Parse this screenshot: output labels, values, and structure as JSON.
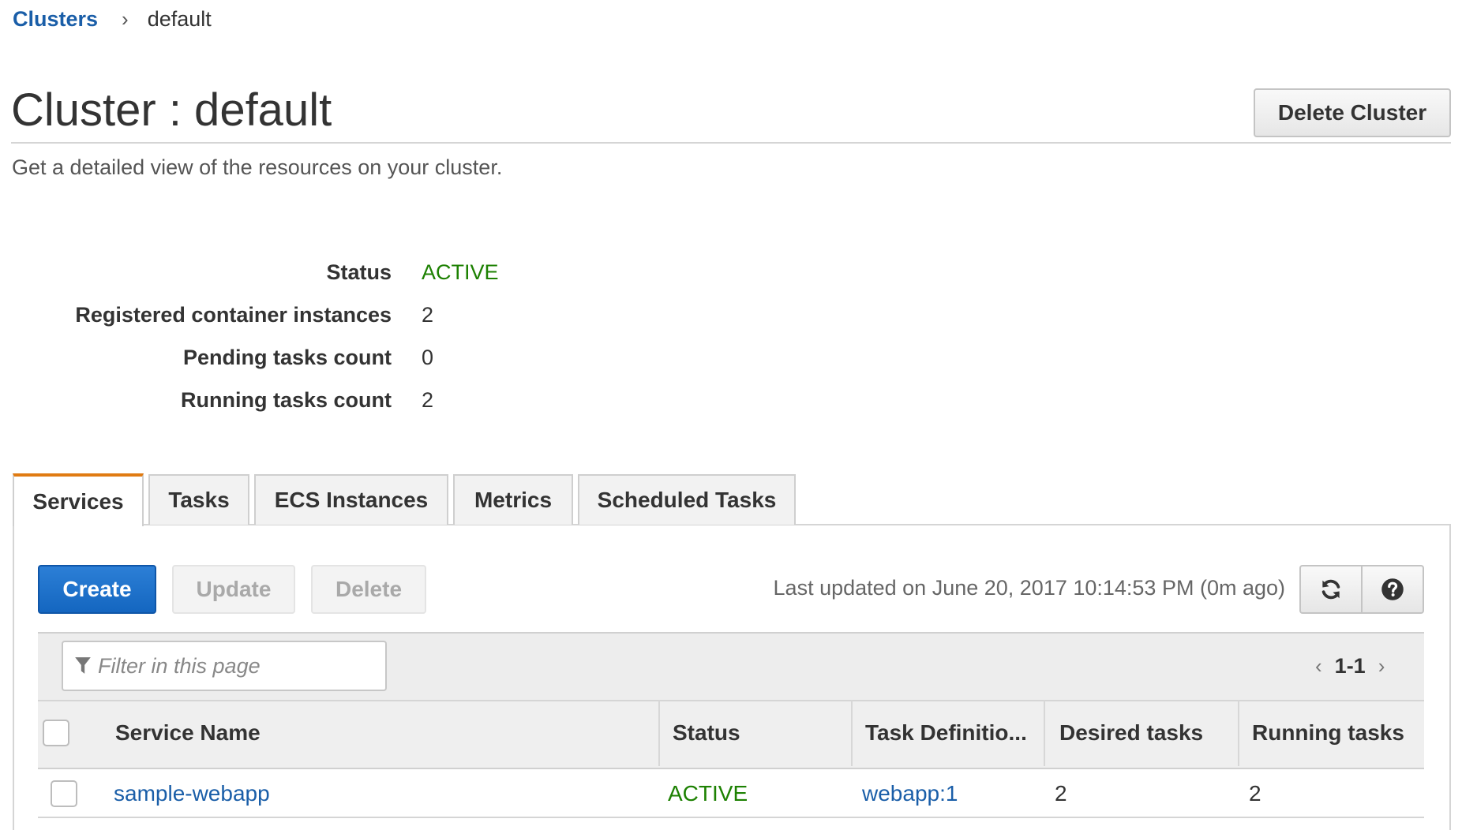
{
  "breadcrumb": {
    "root": "Clusters",
    "separator": "›",
    "current": "default"
  },
  "header": {
    "title": "Cluster : default",
    "subtitle": "Get a detailed view of the resources on your cluster.",
    "delete_cluster_label": "Delete Cluster"
  },
  "details": [
    {
      "label": "Status",
      "value": "ACTIVE"
    },
    {
      "label": "Registered container instances",
      "value": "2"
    },
    {
      "label": "Pending tasks count",
      "value": "0"
    },
    {
      "label": "Running tasks count",
      "value": "2"
    }
  ],
  "tabs": [
    {
      "label": "Services",
      "active": true
    },
    {
      "label": "Tasks",
      "active": false
    },
    {
      "label": "ECS Instances",
      "active": false
    },
    {
      "label": "Metrics",
      "active": false
    },
    {
      "label": "Scheduled Tasks",
      "active": false
    }
  ],
  "actions": {
    "create_label": "Create",
    "update_label": "Update",
    "delete_label": "Delete",
    "last_updated": "Last updated on June 20, 2017 10:14:53 PM (0m ago)",
    "refresh_icon": "refresh-icon",
    "help_icon": "help-icon"
  },
  "filter": {
    "placeholder": "Filter in this page",
    "icon": "filter-icon"
  },
  "pagination": {
    "range": "1-1"
  },
  "table": {
    "columns": [
      "Service Name",
      "Status",
      "Task Definitio...",
      "Desired tasks",
      "Running tasks"
    ],
    "rows": [
      {
        "service_name": "sample-webapp",
        "status": "ACTIVE",
        "task_definition": "webapp:1",
        "desired_tasks": "2",
        "running_tasks": "2"
      }
    ]
  },
  "colors": {
    "link": "#1a5ea8",
    "active_status": "#1d8102",
    "primary_button": "#1466c0",
    "active_tab_accent": "#e07b12"
  }
}
